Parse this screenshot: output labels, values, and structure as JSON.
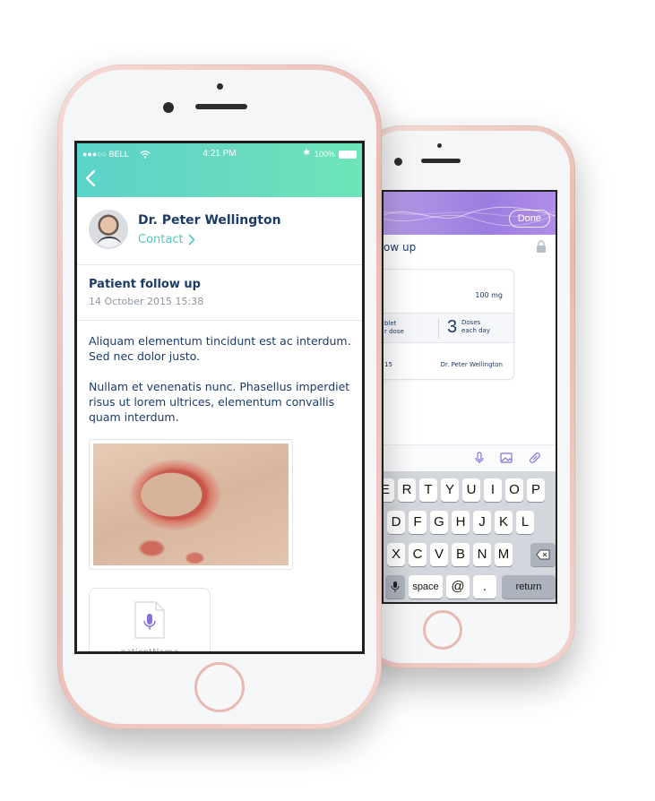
{
  "front": {
    "status": {
      "carrier": "●●●○○ BELL",
      "time": "4:21 PM",
      "battery": "100%"
    },
    "doctor": {
      "name": "Dr. Peter Wellington",
      "contact_label": "Contact"
    },
    "message": {
      "title": "Patient follow up",
      "date": "14 October 2015 15:38",
      "paragraphs": [
        "Aliquam elementum tincidunt est ac interdum. Sed nec dolor justo.",
        "Nullam et venenatis nunc. Phasellus imperdiet risus ut lorem ultrices, elementum convallis quam interdum."
      ]
    },
    "attachment": {
      "audio_name": "patientName"
    }
  },
  "back": {
    "done_label": "Done",
    "title": "ow up",
    "card": {
      "dose": "100 mg",
      "tablet_line1": "blet",
      "tablet_line2": "r dose",
      "doses_count": "3",
      "doses_label": "Doses",
      "doses_freq": "each day",
      "start": "15",
      "doctor": "Dr. Peter Wellington"
    },
    "keyboard": {
      "row1": [
        "E",
        "R",
        "T",
        "Y",
        "U",
        "I",
        "O",
        "P"
      ],
      "row2": [
        "D",
        "F",
        "G",
        "H",
        "J",
        "K",
        "L"
      ],
      "row3": [
        "X",
        "C",
        "V",
        "B",
        "N",
        "M"
      ],
      "space_label": "space",
      "at_label": "@",
      "dot_label": ".",
      "return_label": "return"
    }
  },
  "colors": {
    "teal_accent": "#52c8bb",
    "navy_text": "#1c3b66",
    "purple_header": "#9b7de0",
    "rose_gold": "#e8b9b1"
  }
}
